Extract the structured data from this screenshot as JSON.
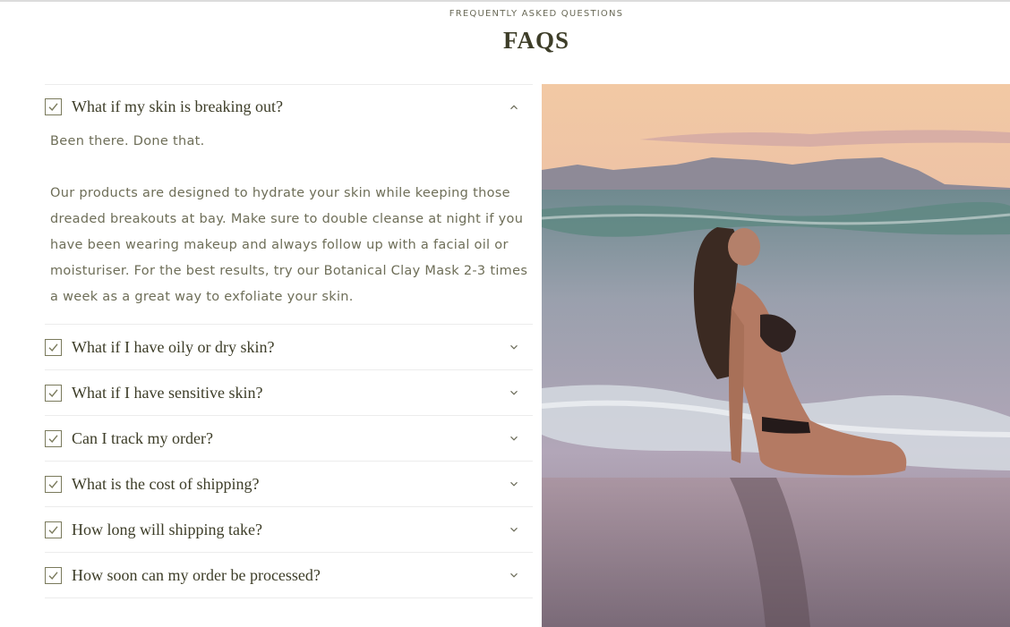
{
  "header": {
    "eyebrow": "FREQUENTLY ASKED QUESTIONS",
    "title": "FAQS"
  },
  "faq": {
    "items": [
      {
        "question": "What if my skin is breaking out?",
        "expanded": true,
        "answer_paragraphs": [
          "Been there. Done that.",
          "Our products are designed to hydrate your skin while keeping those dreaded breakouts at bay. Make sure to double cleanse at night if you have been wearing makeup and always follow up with a facial oil or moisturiser. For the best results, try our Botanical Clay Mask 2-3 times a week as a great way to exfoliate your skin."
        ]
      },
      {
        "question": "What if I have oily or dry skin?",
        "expanded": false
      },
      {
        "question": "What if I have sensitive skin?",
        "expanded": false
      },
      {
        "question": "Can I track my order?",
        "expanded": false
      },
      {
        "question": "What is the cost of shipping?",
        "expanded": false
      },
      {
        "question": "How long will shipping take?",
        "expanded": false
      },
      {
        "question": "How soon can my order be processed?",
        "expanded": false
      }
    ]
  },
  "icons": {
    "item_marker": "checkbox-check-icon",
    "expanded": "chevron-up-icon",
    "collapsed": "chevron-down-icon"
  },
  "colors": {
    "text_dark": "#3d3d28",
    "text_body": "#6e6e58",
    "divider": "#ececec"
  }
}
